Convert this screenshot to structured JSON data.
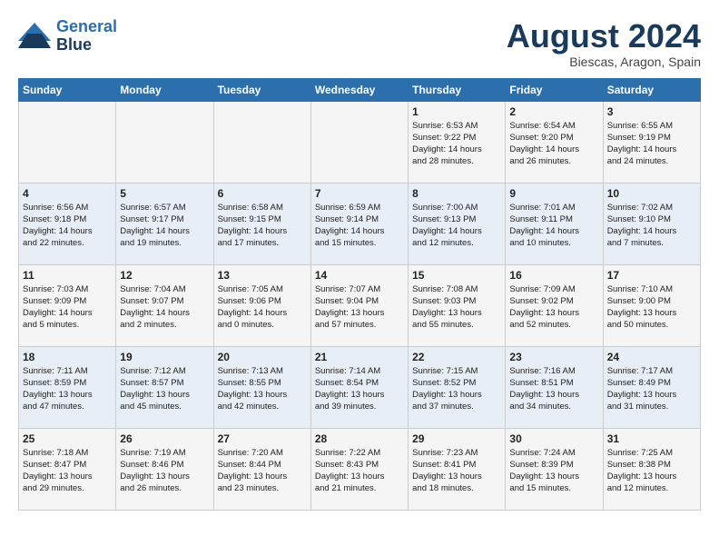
{
  "header": {
    "logo_line1": "General",
    "logo_line2": "Blue",
    "main_title": "August 2024",
    "subtitle": "Biescas, Aragon, Spain"
  },
  "calendar": {
    "days_of_week": [
      "Sunday",
      "Monday",
      "Tuesday",
      "Wednesday",
      "Thursday",
      "Friday",
      "Saturday"
    ],
    "weeks": [
      [
        {
          "day": "",
          "info": ""
        },
        {
          "day": "",
          "info": ""
        },
        {
          "day": "",
          "info": ""
        },
        {
          "day": "",
          "info": ""
        },
        {
          "day": "1",
          "info": "Sunrise: 6:53 AM\nSunset: 9:22 PM\nDaylight: 14 hours\nand 28 minutes."
        },
        {
          "day": "2",
          "info": "Sunrise: 6:54 AM\nSunset: 9:20 PM\nDaylight: 14 hours\nand 26 minutes."
        },
        {
          "day": "3",
          "info": "Sunrise: 6:55 AM\nSunset: 9:19 PM\nDaylight: 14 hours\nand 24 minutes."
        }
      ],
      [
        {
          "day": "4",
          "info": "Sunrise: 6:56 AM\nSunset: 9:18 PM\nDaylight: 14 hours\nand 22 minutes."
        },
        {
          "day": "5",
          "info": "Sunrise: 6:57 AM\nSunset: 9:17 PM\nDaylight: 14 hours\nand 19 minutes."
        },
        {
          "day": "6",
          "info": "Sunrise: 6:58 AM\nSunset: 9:15 PM\nDaylight: 14 hours\nand 17 minutes."
        },
        {
          "day": "7",
          "info": "Sunrise: 6:59 AM\nSunset: 9:14 PM\nDaylight: 14 hours\nand 15 minutes."
        },
        {
          "day": "8",
          "info": "Sunrise: 7:00 AM\nSunset: 9:13 PM\nDaylight: 14 hours\nand 12 minutes."
        },
        {
          "day": "9",
          "info": "Sunrise: 7:01 AM\nSunset: 9:11 PM\nDaylight: 14 hours\nand 10 minutes."
        },
        {
          "day": "10",
          "info": "Sunrise: 7:02 AM\nSunset: 9:10 PM\nDaylight: 14 hours\nand 7 minutes."
        }
      ],
      [
        {
          "day": "11",
          "info": "Sunrise: 7:03 AM\nSunset: 9:09 PM\nDaylight: 14 hours\nand 5 minutes."
        },
        {
          "day": "12",
          "info": "Sunrise: 7:04 AM\nSunset: 9:07 PM\nDaylight: 14 hours\nand 2 minutes."
        },
        {
          "day": "13",
          "info": "Sunrise: 7:05 AM\nSunset: 9:06 PM\nDaylight: 14 hours\nand 0 minutes."
        },
        {
          "day": "14",
          "info": "Sunrise: 7:07 AM\nSunset: 9:04 PM\nDaylight: 13 hours\nand 57 minutes."
        },
        {
          "day": "15",
          "info": "Sunrise: 7:08 AM\nSunset: 9:03 PM\nDaylight: 13 hours\nand 55 minutes."
        },
        {
          "day": "16",
          "info": "Sunrise: 7:09 AM\nSunset: 9:02 PM\nDaylight: 13 hours\nand 52 minutes."
        },
        {
          "day": "17",
          "info": "Sunrise: 7:10 AM\nSunset: 9:00 PM\nDaylight: 13 hours\nand 50 minutes."
        }
      ],
      [
        {
          "day": "18",
          "info": "Sunrise: 7:11 AM\nSunset: 8:59 PM\nDaylight: 13 hours\nand 47 minutes."
        },
        {
          "day": "19",
          "info": "Sunrise: 7:12 AM\nSunset: 8:57 PM\nDaylight: 13 hours\nand 45 minutes."
        },
        {
          "day": "20",
          "info": "Sunrise: 7:13 AM\nSunset: 8:55 PM\nDaylight: 13 hours\nand 42 minutes."
        },
        {
          "day": "21",
          "info": "Sunrise: 7:14 AM\nSunset: 8:54 PM\nDaylight: 13 hours\nand 39 minutes."
        },
        {
          "day": "22",
          "info": "Sunrise: 7:15 AM\nSunset: 8:52 PM\nDaylight: 13 hours\nand 37 minutes."
        },
        {
          "day": "23",
          "info": "Sunrise: 7:16 AM\nSunset: 8:51 PM\nDaylight: 13 hours\nand 34 minutes."
        },
        {
          "day": "24",
          "info": "Sunrise: 7:17 AM\nSunset: 8:49 PM\nDaylight: 13 hours\nand 31 minutes."
        }
      ],
      [
        {
          "day": "25",
          "info": "Sunrise: 7:18 AM\nSunset: 8:47 PM\nDaylight: 13 hours\nand 29 minutes."
        },
        {
          "day": "26",
          "info": "Sunrise: 7:19 AM\nSunset: 8:46 PM\nDaylight: 13 hours\nand 26 minutes."
        },
        {
          "day": "27",
          "info": "Sunrise: 7:20 AM\nSunset: 8:44 PM\nDaylight: 13 hours\nand 23 minutes."
        },
        {
          "day": "28",
          "info": "Sunrise: 7:22 AM\nSunset: 8:43 PM\nDaylight: 13 hours\nand 21 minutes."
        },
        {
          "day": "29",
          "info": "Sunrise: 7:23 AM\nSunset: 8:41 PM\nDaylight: 13 hours\nand 18 minutes."
        },
        {
          "day": "30",
          "info": "Sunrise: 7:24 AM\nSunset: 8:39 PM\nDaylight: 13 hours\nand 15 minutes."
        },
        {
          "day": "31",
          "info": "Sunrise: 7:25 AM\nSunset: 8:38 PM\nDaylight: 13 hours\nand 12 minutes."
        }
      ]
    ]
  }
}
